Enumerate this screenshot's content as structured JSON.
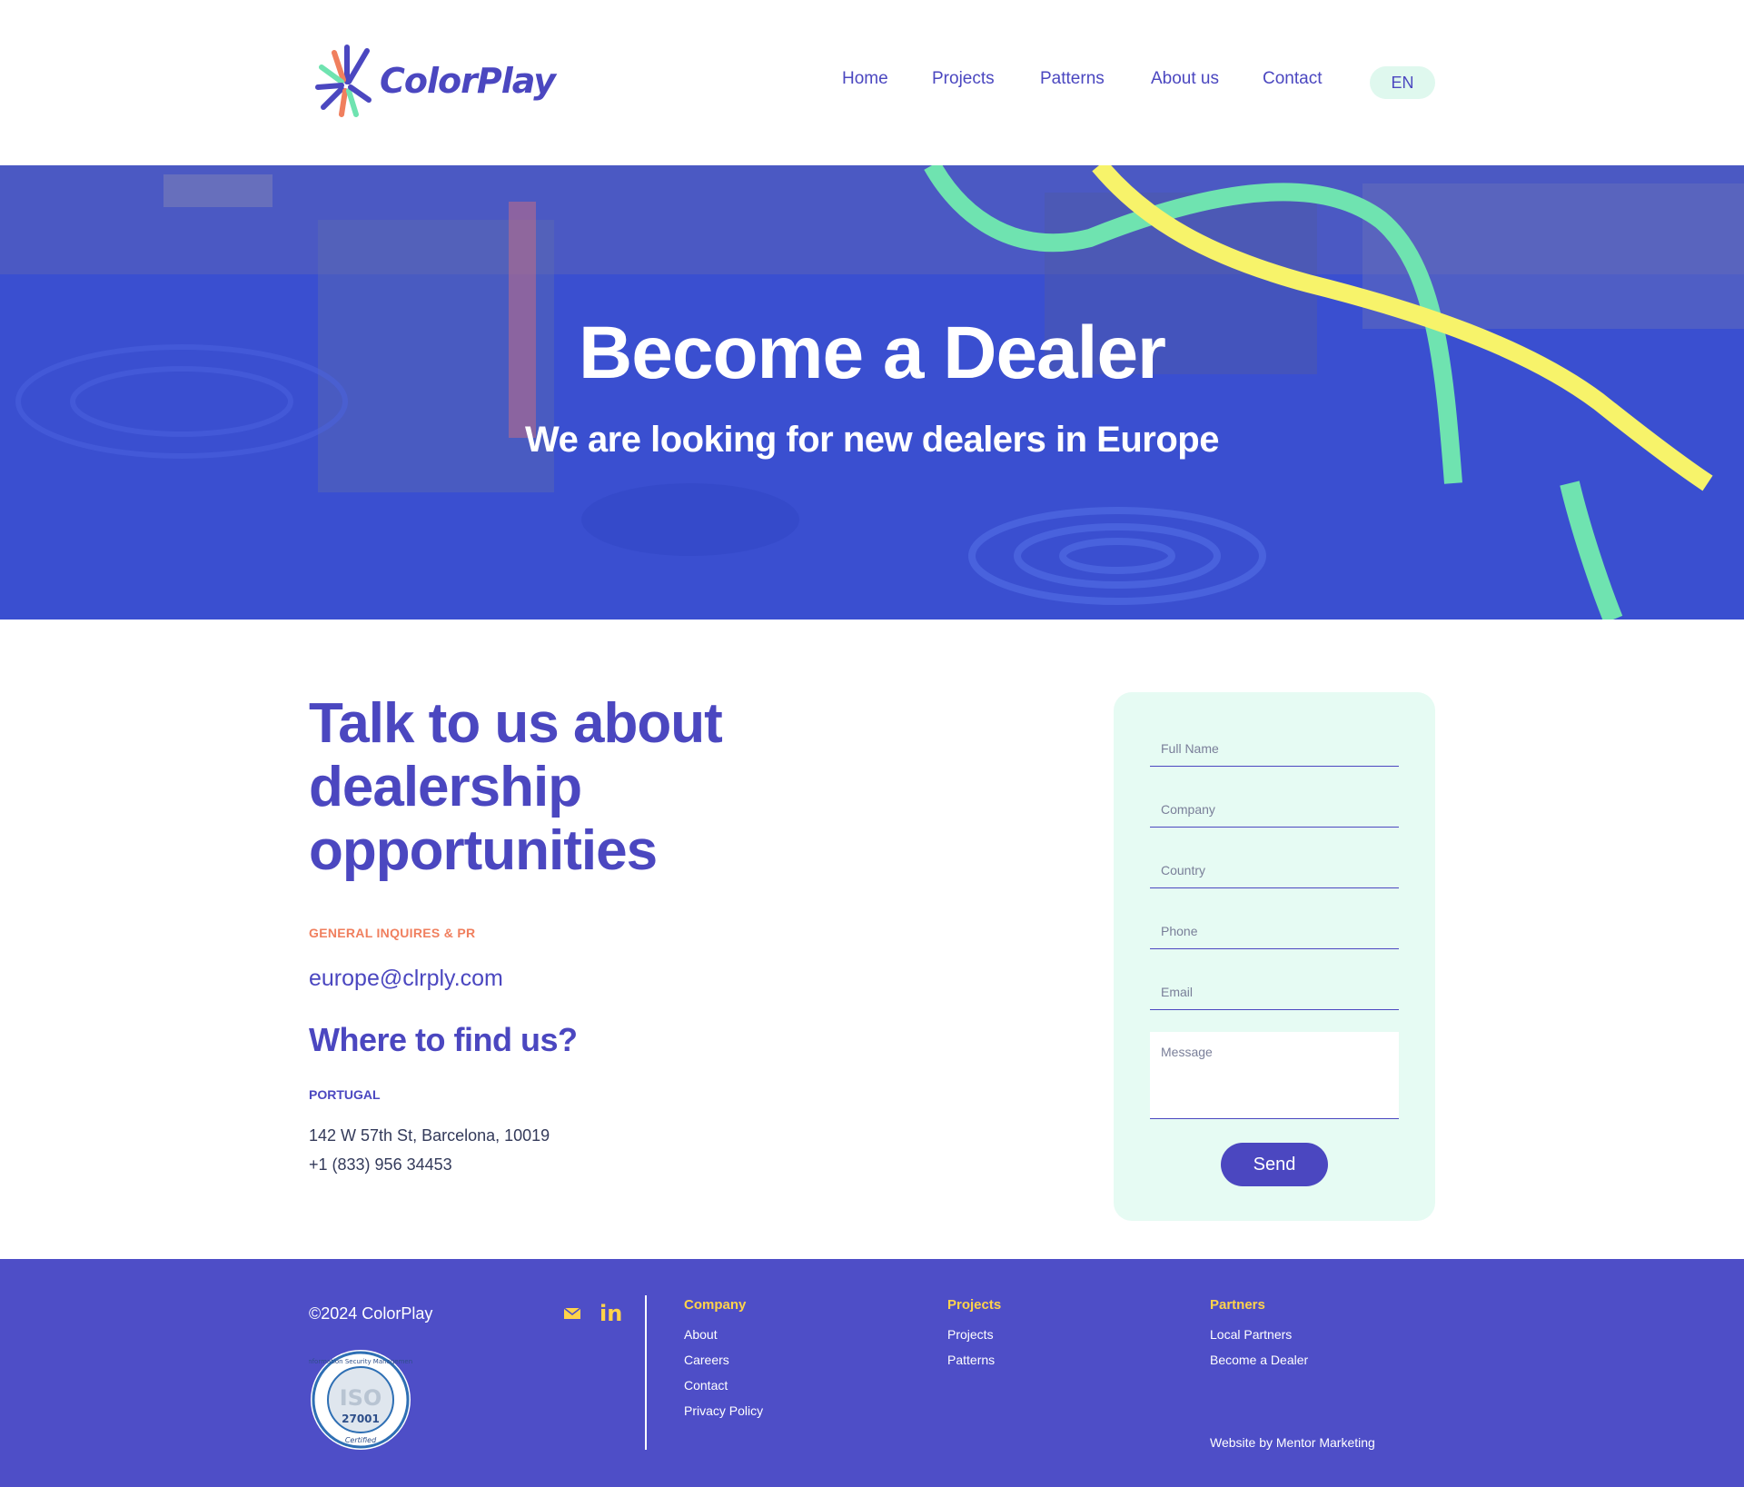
{
  "brand": {
    "name": "ColorPlay"
  },
  "nav": {
    "items": [
      {
        "label": "Home"
      },
      {
        "label": "Projects"
      },
      {
        "label": "Patterns"
      },
      {
        "label": "About us"
      },
      {
        "label": "Contact"
      }
    ],
    "language": "EN"
  },
  "hero": {
    "title": "Become a Dealer",
    "subtitle": "We are looking for new dealers in Europe"
  },
  "contact": {
    "heading": "Talk to us about dealership opportunities",
    "inquiries_label": "GENERAL INQUIRES & PR",
    "email": "europe@clrply.com",
    "where_heading": "Where to find us?",
    "country": "PORTUGAL",
    "address": "142 W 57th St, Barcelona, 10019",
    "phone": "+1 (833) 956 34453"
  },
  "form": {
    "fields": [
      {
        "placeholder": "Full Name"
      },
      {
        "placeholder": "Company"
      },
      {
        "placeholder": "Country"
      },
      {
        "placeholder": "Phone"
      },
      {
        "placeholder": "Email"
      }
    ],
    "message_placeholder": "Message",
    "submit_label": "Send"
  },
  "footer": {
    "copyright": "©2024 ColorPlay",
    "iso_text": "ISO",
    "iso_number": "27001",
    "iso_ring_top": "Information Security Management",
    "iso_ring_bottom": "Certified",
    "social_linkedin": "in",
    "columns": [
      {
        "heading": "Company",
        "links": [
          "About",
          "Careers",
          "Contact",
          "Privacy Policy"
        ]
      },
      {
        "heading": "Projects",
        "links": [
          "Projects",
          "Patterns"
        ]
      },
      {
        "heading": "Partners",
        "links": [
          "Local Partners",
          "Become a Dealer"
        ]
      }
    ],
    "credit": "Website by  Mentor Marketing"
  },
  "colors": {
    "primary": "#4b47c0",
    "accent_orange": "#f07f5e",
    "accent_yellow": "#ffd34a",
    "mint": "#e6fbf3",
    "hero_blue": "#3a56d6",
    "ribbon_green": "#6fe3b0",
    "ribbon_yellow": "#f7f36a"
  },
  "icons": [
    "logo-burst-icon",
    "mail-icon",
    "linkedin-icon",
    "iso-badge-icon"
  ]
}
